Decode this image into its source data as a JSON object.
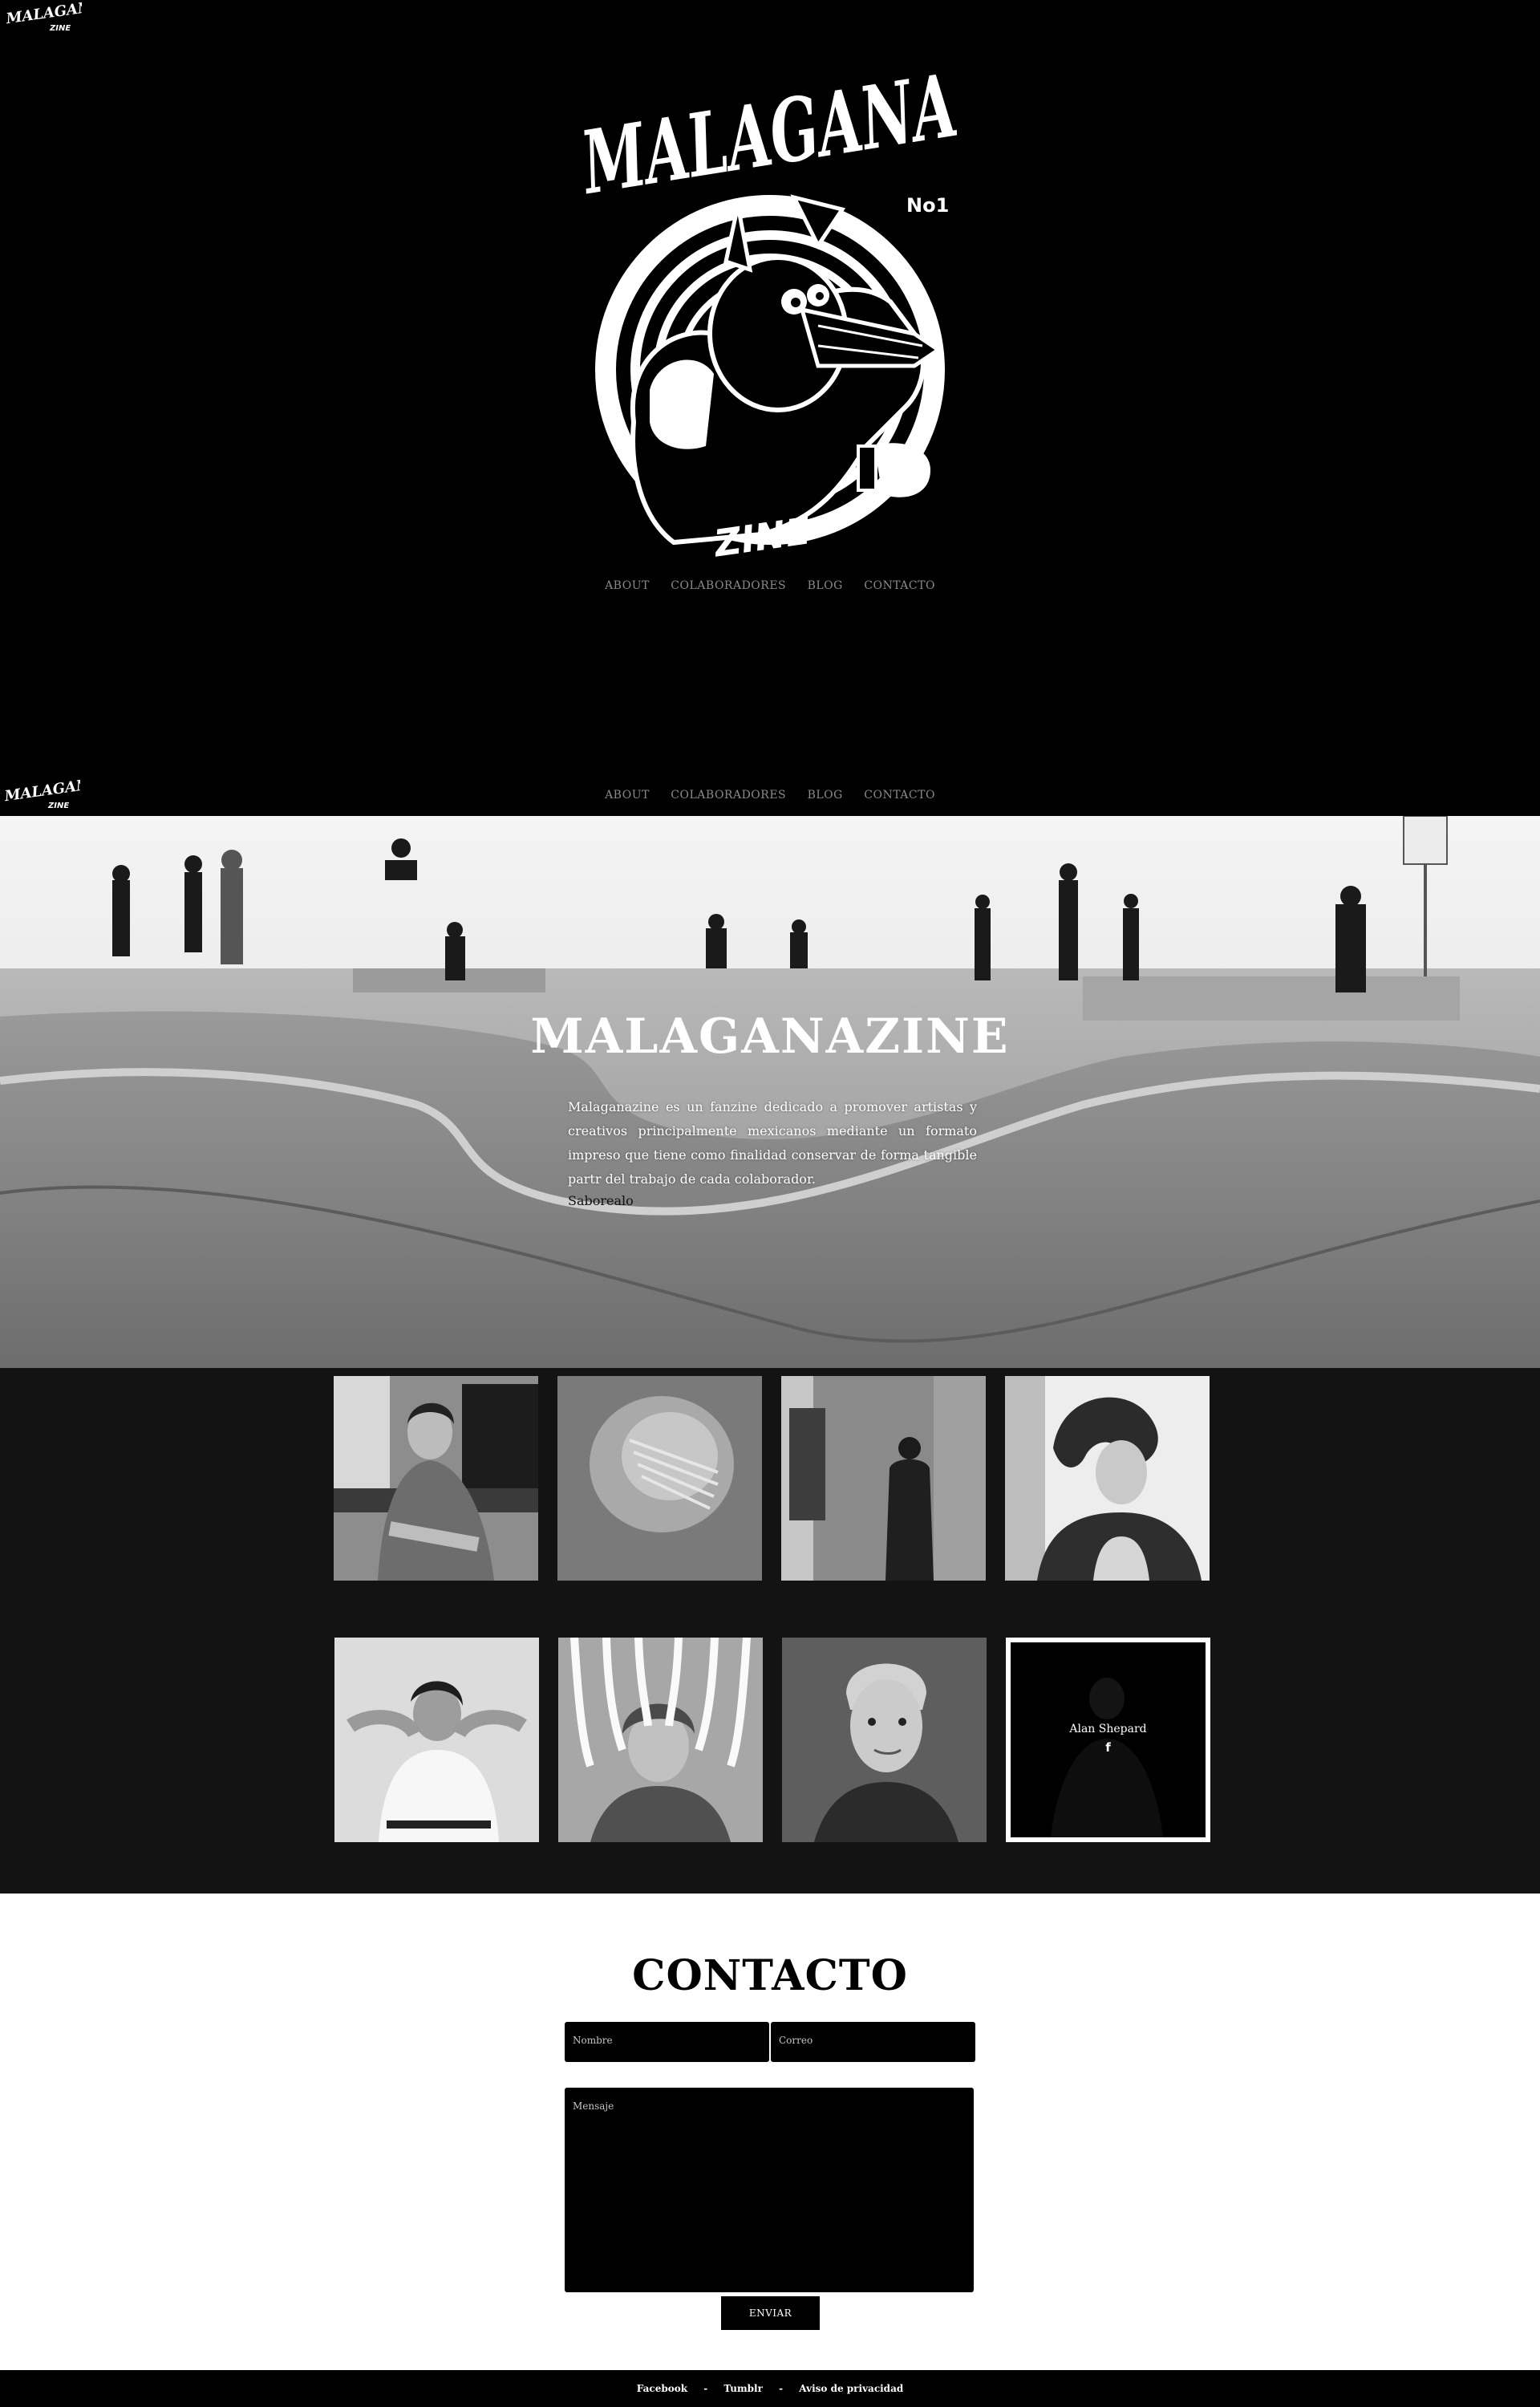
{
  "brand": {
    "logo_text": "MALAGANA",
    "logo_sub": "ZINE",
    "issue": "No1"
  },
  "nav": {
    "items": [
      "ABOUT",
      "COLABORADORES",
      "BLOG",
      "CONTACTO"
    ]
  },
  "about": {
    "title": "MALAGANAZINE",
    "text": "Malaganazine es un fanzine dedicado a promover artistas y creativos principalmente mexicanos mediante un formato impreso que tiene como finalidad conservar de forma tangible partr del trabajo de cada colaborador.",
    "tagline": "Saborealo"
  },
  "collaborators": {
    "active": {
      "name": "Alan Shepard",
      "social_icon": "facebook-icon",
      "social_glyph": "f"
    }
  },
  "contact": {
    "title": "CONTACTO",
    "name_placeholder": "Nombre",
    "email_placeholder": "Correo",
    "message_placeholder": "Mensaje",
    "send_label": "ENVIAR"
  },
  "footer": {
    "links": [
      "Facebook",
      "Tumblr",
      "Aviso de privacidad"
    ],
    "separator": "-"
  }
}
